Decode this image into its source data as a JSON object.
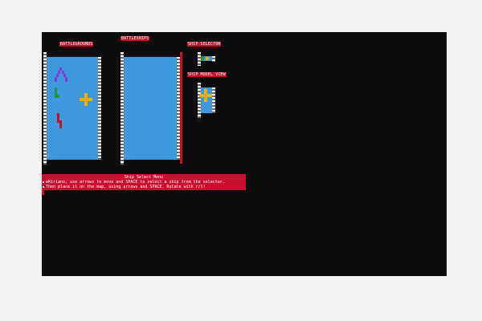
{
  "labels": {
    "battlegrounds": "BATTLEGROUNDS",
    "battleships": "BATTLESHIPS",
    "ship_selector": "SHIP SELECTOR",
    "ship_model_view": "SHIP MODEL VIEW"
  },
  "menu": {
    "title": "Ship Select Menu",
    "line1": "eKiriano, use arrows to move and SPACE to select a ship from the selector.",
    "line2": "Then place it on the map, using arrows and SPACE. Rotate with r/l!"
  },
  "colors": {
    "screen_bg": "#0c0c0c",
    "water": "#3f97dc",
    "accent_red": "#c8102e",
    "ship_purple": "#7b3fd4",
    "ship_green": "#1f9a3a",
    "ship_yellow": "#e0b21a",
    "ship_red": "#c8102e"
  },
  "icons": {
    "ship_a": "purple-ship-icon",
    "ship_b": "green-ship-icon",
    "ship_c": "yellow-cross-ship-icon",
    "ship_d": "red-zigzag-ship-icon",
    "selector_ship": "blue-ship-icon"
  }
}
